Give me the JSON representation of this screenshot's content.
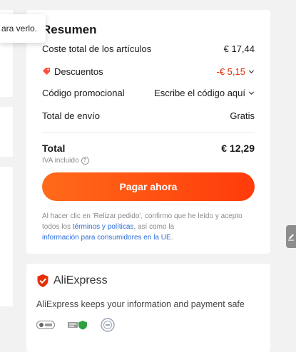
{
  "tooltip": {
    "text": "ara verlo."
  },
  "summary": {
    "title": "Resumen",
    "items": {
      "subtotal_label": "Coste total de los artículos",
      "subtotal_value": "€ 17,44",
      "discounts_label": "Descuentos",
      "discounts_value": "-€ 5,15",
      "promo_label": "Código promocional",
      "promo_value": "Escribe el código aquí",
      "shipping_label": "Total de envío",
      "shipping_value": "Gratis"
    },
    "total_label": "Total",
    "total_value": "€ 12,29",
    "vat_note": "IVA incluido",
    "pay_button": "Pagar ahora",
    "legal": {
      "part1": "Al hacer clic en 'Relizar pedido', confirmo que he leído y acepto todos los ",
      "terms_link": "términos y políticas",
      "part2": ", así como la ",
      "consumer_link": "información para consumidores en la UE",
      "part3": "."
    }
  },
  "trust": {
    "brand": "AliExpress",
    "text": "AliExpress keeps your information and payment safe"
  },
  "colors": {
    "accent": "#ff4d0a",
    "discount": "#e62e04",
    "link": "#2b6ed9"
  },
  "icons": [
    "coupon-tag-icon",
    "chevron-down-icon",
    "info-icon",
    "aliexpress-shield-logo",
    "security-badge-icon",
    "feedback-edit-icon"
  ]
}
